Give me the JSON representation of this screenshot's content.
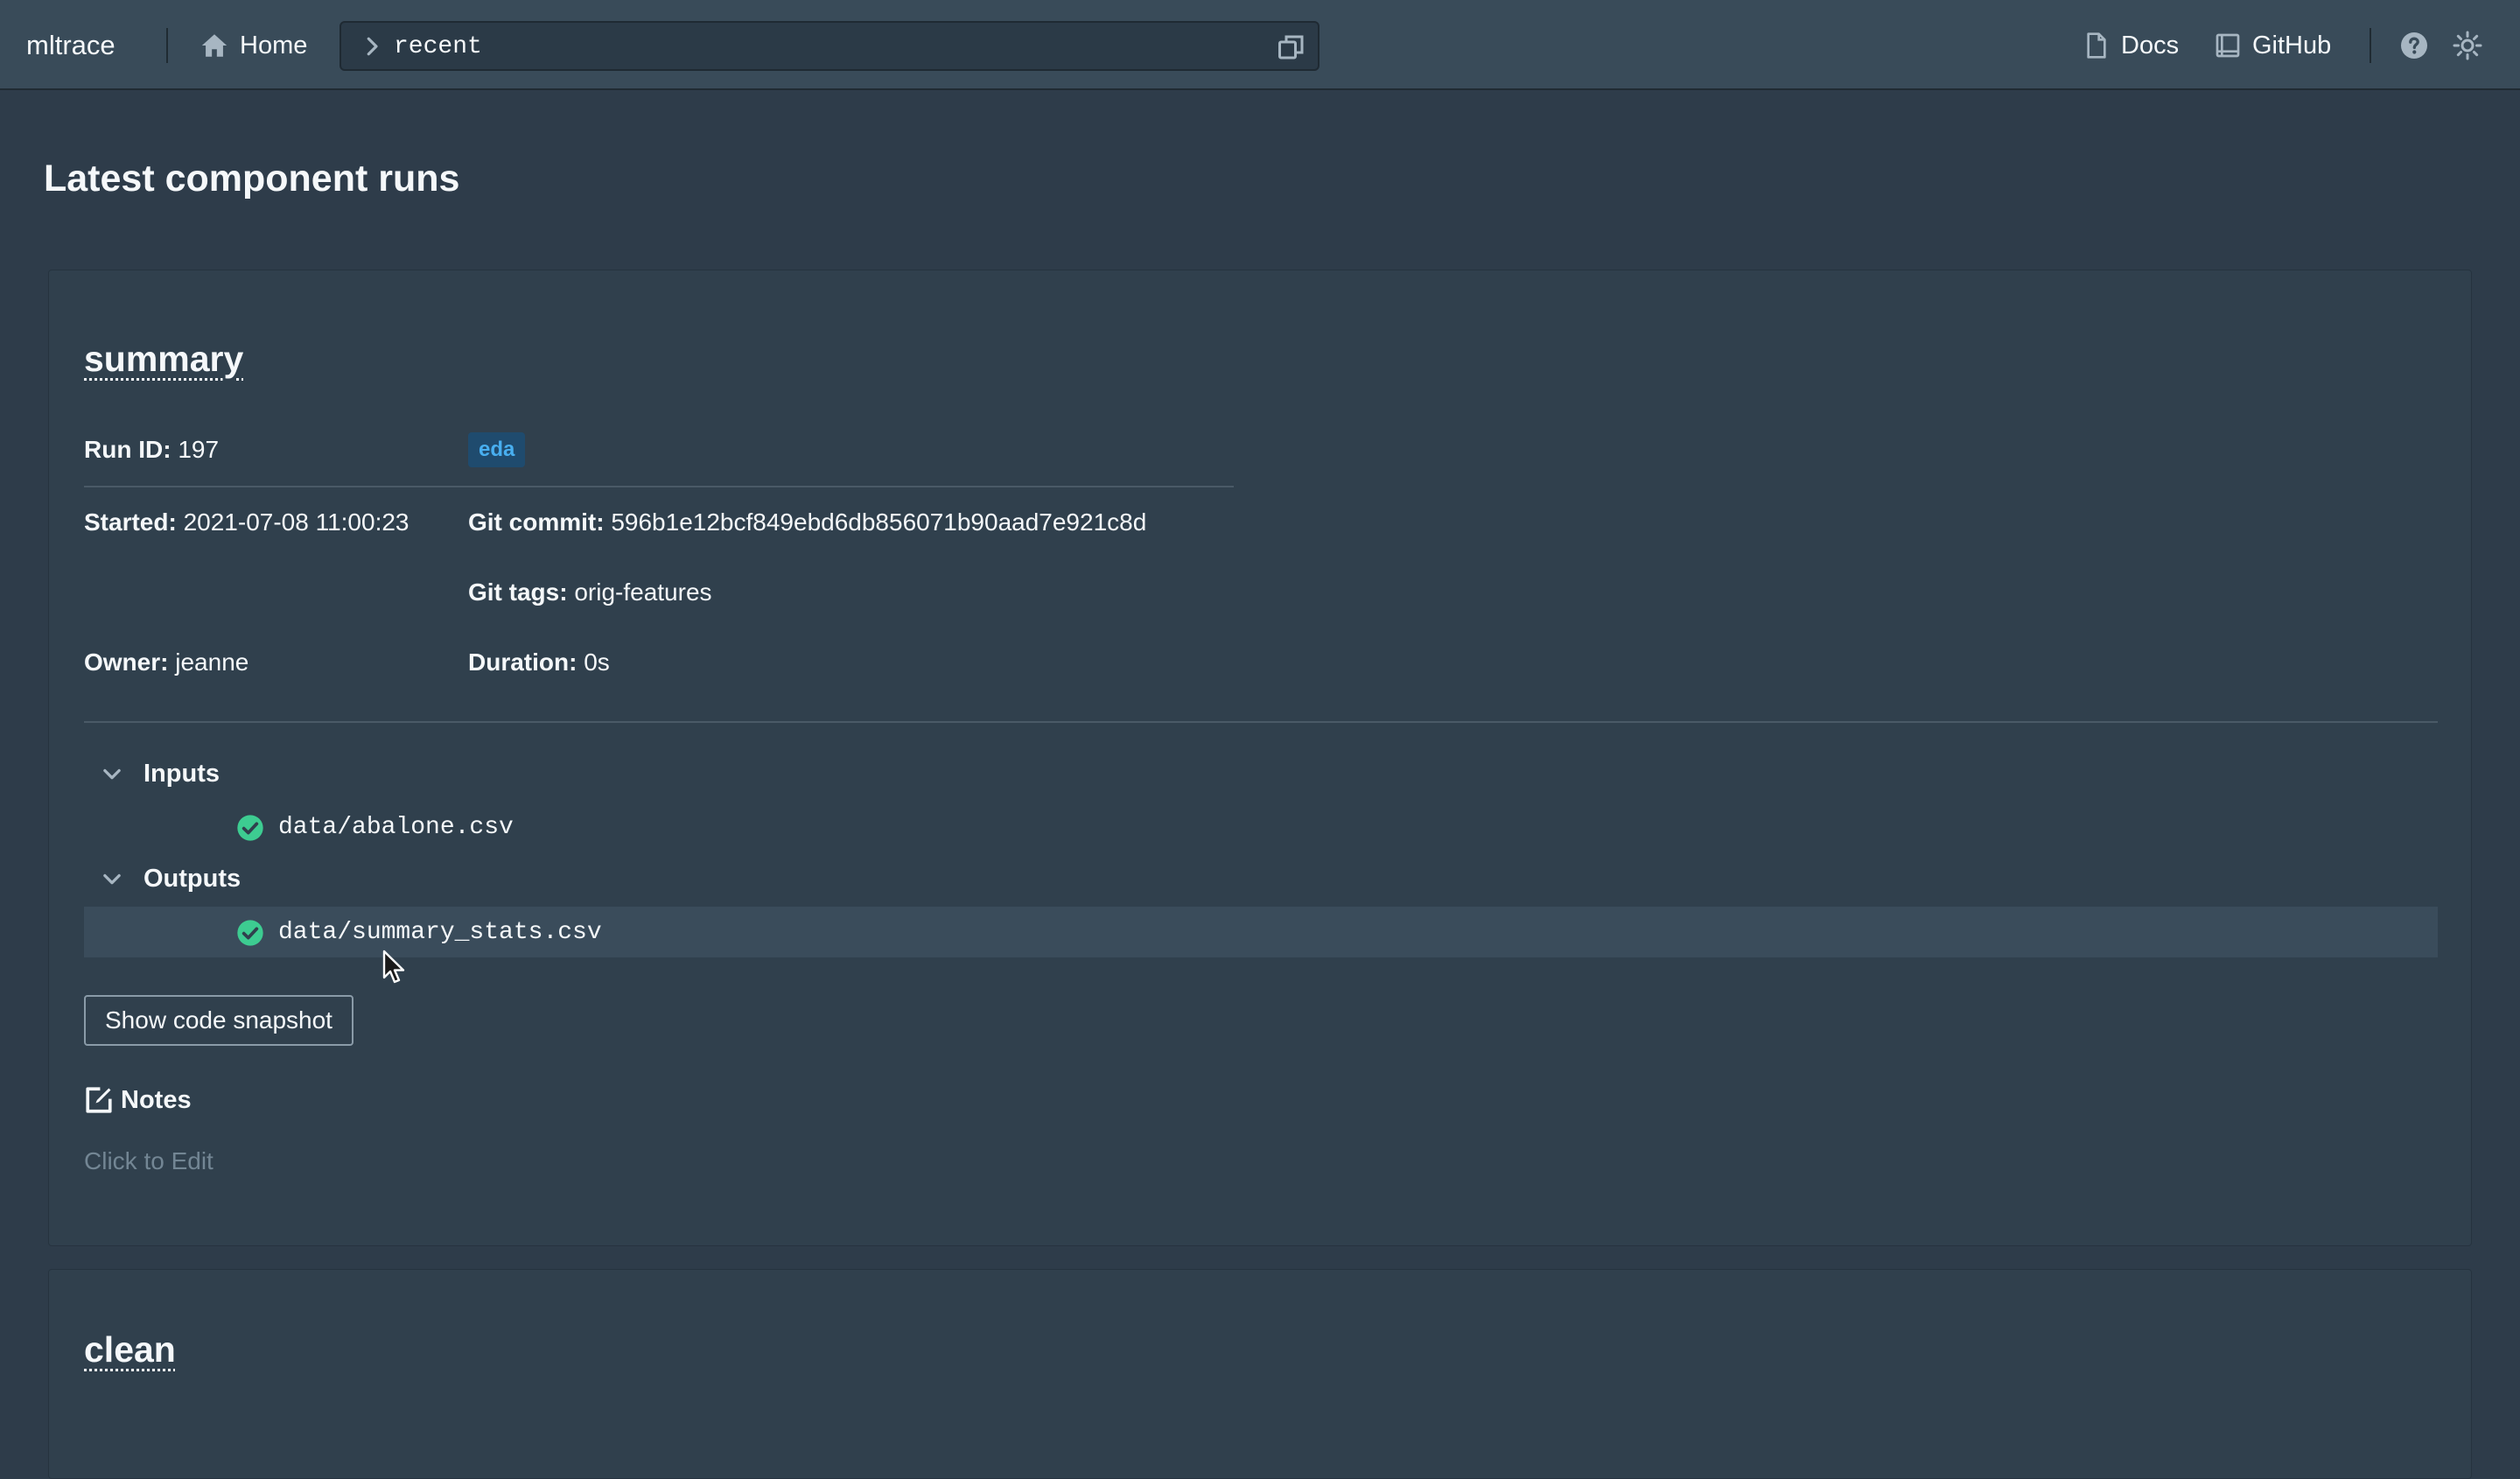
{
  "navbar": {
    "brand": "mltrace",
    "home_label": "Home",
    "search_value": "recent",
    "docs_label": "Docs",
    "github_label": "GitHub"
  },
  "page": {
    "title": "Latest component runs"
  },
  "runs": [
    {
      "name": "summary",
      "run_id_label": "Run ID:",
      "run_id": "197",
      "tag": "eda",
      "started_label": "Started:",
      "started": "2021-07-08 11:00:23",
      "git_commit_label": "Git commit:",
      "git_commit": "596b1e12bcf849ebd6db856071b90aad7e921c8d",
      "git_tags_label": "Git tags:",
      "git_tags": "orig-features",
      "owner_label": "Owner:",
      "owner": "jeanne",
      "duration_label": "Duration:",
      "duration": "0s",
      "inputs_label": "Inputs",
      "inputs": [
        "data/abalone.csv"
      ],
      "outputs_label": "Outputs",
      "outputs": [
        "data/summary_stats.csv"
      ],
      "snapshot_button": "Show code snapshot",
      "notes_label": "Notes",
      "notes_placeholder": "Click to Edit"
    },
    {
      "name": "clean"
    }
  ],
  "colors": {
    "background": "#2e3c4a",
    "navbar": "#394b59",
    "card": "#30404d",
    "tag_bg": "#1f4b6e",
    "tag_text": "#48aff0",
    "success": "#3dcc91"
  }
}
